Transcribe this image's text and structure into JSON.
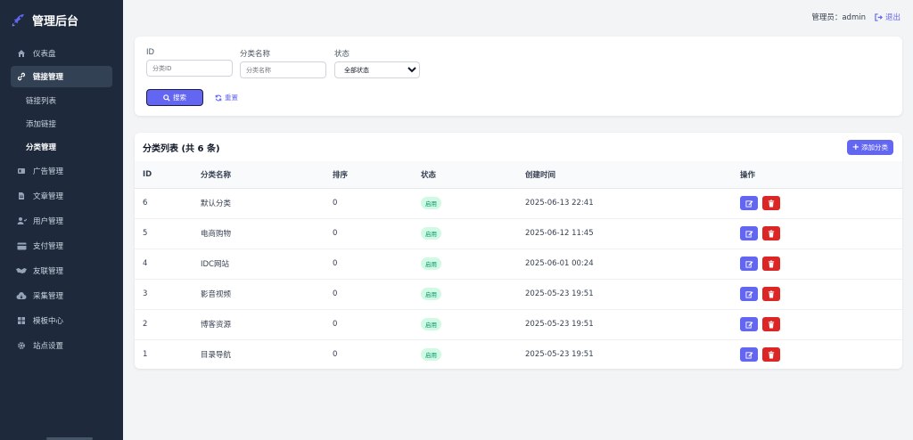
{
  "brand": {
    "title": "管理后台",
    "accent": "#6366f1"
  },
  "sidebar": {
    "items": [
      {
        "label": "仪表盘",
        "icon": "home-icon"
      },
      {
        "label": "链接管理",
        "icon": "link-icon",
        "active": true,
        "children": [
          "链接列表",
          "添加链接",
          "分类管理"
        ]
      },
      {
        "label": "广告管理",
        "icon": "ad-icon"
      },
      {
        "label": "文章管理",
        "icon": "file-icon"
      },
      {
        "label": "用户管理",
        "icon": "users-icon"
      },
      {
        "label": "支付管理",
        "icon": "credit-card-icon"
      },
      {
        "label": "友联管理",
        "icon": "handshake-icon"
      },
      {
        "label": "采集管理",
        "icon": "cloud-download-icon"
      },
      {
        "label": "模板中心",
        "icon": "grid-icon"
      },
      {
        "label": "站点设置",
        "icon": "gear-icon"
      }
    ],
    "current_child": "分类管理"
  },
  "topbar": {
    "admin": "管理员：admin",
    "logout": "退出"
  },
  "search": {
    "id_label": "ID",
    "id_placeholder": "分类ID",
    "name_label": "分类名称",
    "name_placeholder": "分类名称",
    "status_label": "状态",
    "status_selected": "全部状态",
    "search_button": "搜索",
    "reset_button": "重置"
  },
  "list": {
    "title": "分类列表 (共 6 条)",
    "add_button": "添加分类",
    "columns": [
      "ID",
      "分类名称",
      "排序",
      "状态",
      "创建时间",
      "操作"
    ],
    "rows": [
      {
        "id": "6",
        "name": "默认分类",
        "sort": "0",
        "status": "启用",
        "created": "2025-06-13 22:41"
      },
      {
        "id": "5",
        "name": "电商购物",
        "sort": "0",
        "status": "启用",
        "created": "2025-06-12 11:45"
      },
      {
        "id": "4",
        "name": "IDC网站",
        "sort": "0",
        "status": "启用",
        "created": "2025-06-01 00:24"
      },
      {
        "id": "3",
        "name": "影音视频",
        "sort": "0",
        "status": "启用",
        "created": "2025-05-23 19:51"
      },
      {
        "id": "2",
        "name": "博客资源",
        "sort": "0",
        "status": "启用",
        "created": "2025-05-23 19:51"
      },
      {
        "id": "1",
        "name": "目录导航",
        "sort": "0",
        "status": "启用",
        "created": "2025-05-23 19:51"
      }
    ]
  }
}
